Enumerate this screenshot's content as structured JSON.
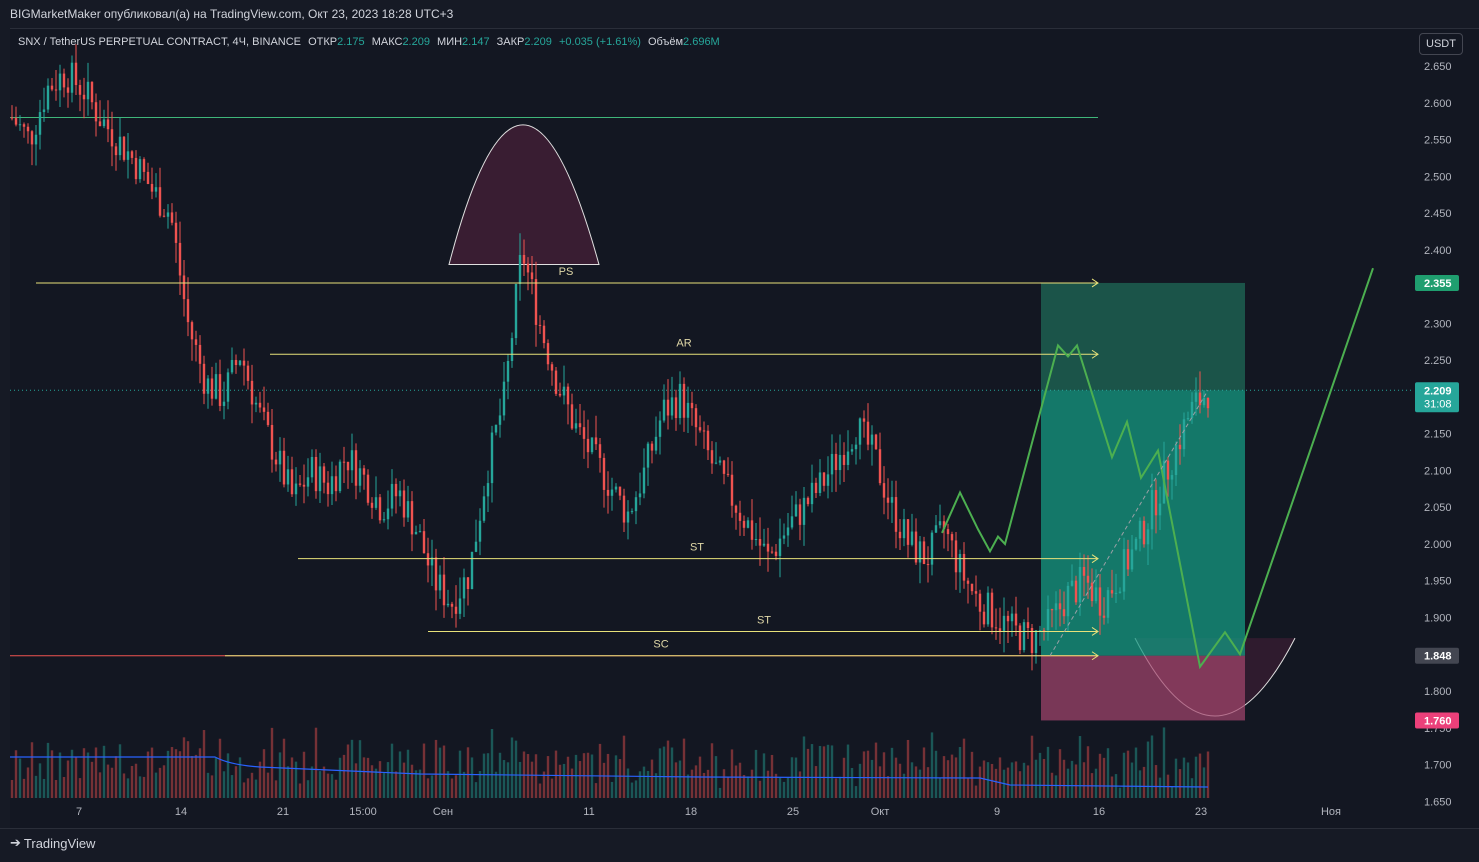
{
  "header": {
    "publish_line": "BIGMarketMaker опубликовал(а) на TradingView.com, Окт 23, 2023 18:28 UTC+3"
  },
  "legend": {
    "symbol": "SNX / TetherUS PERPETUAL CONTRACT, 4Ч, BINANCE",
    "open_label": "ОТКР",
    "open_value": "2.175",
    "high_label": "МАКС",
    "high_value": "2.209",
    "low_label": "МИН",
    "low_value": "2.147",
    "close_label": "ЗАКР",
    "close_value": "2.209",
    "change": "+0.035 (+1.61%)",
    "volume_label": "Объём",
    "volume_value": "2.696M"
  },
  "price_unit": "USDT",
  "footer": {
    "brand": "TradingView"
  },
  "colors": {
    "up": "#26a69a",
    "down": "#ef5350",
    "level": "#e8e27a",
    "target": "#3fb67a",
    "stop": "#c2185b",
    "volume_ma": "#2962ff"
  },
  "chart_data": {
    "type": "candlestick",
    "x_ticks": [
      "7",
      "14",
      "21",
      "15:00",
      "Сен",
      "11",
      "18",
      "25",
      "Окт",
      "9",
      "16",
      "23",
      "Ноя"
    ],
    "y_ticks": [
      "2.650",
      "2.600",
      "2.550",
      "2.500",
      "2.450",
      "2.400",
      "2.350",
      "2.300",
      "2.250",
      "2.200",
      "2.150",
      "2.100",
      "2.050",
      "2.000",
      "1.950",
      "1.900",
      "1.850",
      "1.800",
      "1.750",
      "1.700",
      "1.650"
    ],
    "ylim": [
      1.645,
      2.665
    ],
    "price_series_approx": [
      2.58,
      2.55,
      2.62,
      2.64,
      2.62,
      2.58,
      2.55,
      2.52,
      2.48,
      2.45,
      2.3,
      2.22,
      2.2,
      2.26,
      2.18,
      2.12,
      2.06,
      2.1,
      2.08,
      2.12,
      2.09,
      2.05,
      2.07,
      2.02,
      1.95,
      1.92,
      1.96,
      2.1,
      2.2,
      2.4,
      2.3,
      2.22,
      2.16,
      2.12,
      2.08,
      2.04,
      2.1,
      2.18,
      2.2,
      2.15,
      2.1,
      2.06,
      2.02,
      1.98,
      2.02,
      2.05,
      2.08,
      2.12,
      2.16,
      2.12,
      2.05,
      2.0,
      1.98,
      2.02,
      1.96,
      1.92,
      1.9,
      1.88,
      1.87,
      1.89,
      1.93,
      1.95,
      1.92,
      1.96,
      2.0,
      2.06,
      2.12,
      2.18,
      2.209
    ],
    "levels": [
      {
        "label": "PS",
        "price": 2.355
      },
      {
        "label": "AR",
        "price": 2.258
      },
      {
        "label": "ST",
        "price": 1.98
      },
      {
        "label": "ST",
        "price": 1.881
      },
      {
        "label": "SC",
        "price": 1.848
      }
    ],
    "top_line_price": 2.58,
    "bottom_line_price": 1.848,
    "price_labels": [
      {
        "value": "2.355",
        "kind": "target"
      },
      {
        "value": "2.209",
        "kind": "last",
        "countdown": "31:08"
      },
      {
        "value": "1.848",
        "kind": "entry"
      },
      {
        "value": "1.760",
        "kind": "stop"
      }
    ],
    "position": {
      "entry": 1.848,
      "target": 2.355,
      "stop": 1.76
    }
  }
}
